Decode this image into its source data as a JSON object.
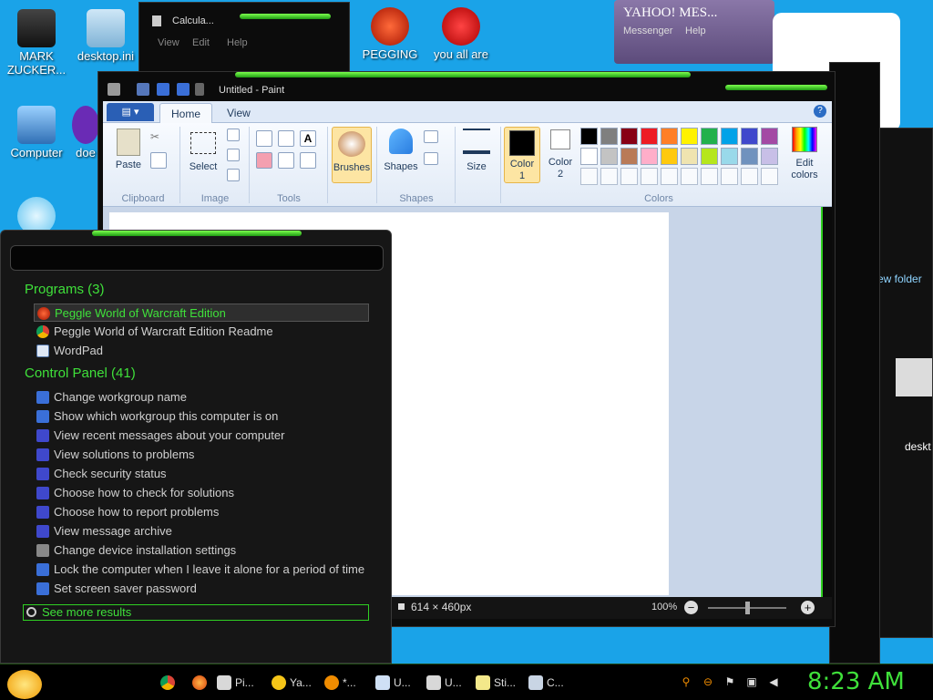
{
  "desktop": {
    "icons": [
      {
        "label": "MARK ZUCKER..."
      },
      {
        "label": "desktop.ini"
      },
      {
        "label": "PEGGING"
      },
      {
        "label": "you all are"
      },
      {
        "label": "Computer"
      },
      {
        "label": "doe"
      },
      {
        "label": "deskt"
      },
      {
        "label": "ew folder"
      }
    ]
  },
  "calculator": {
    "title": "Calcula...",
    "menu": [
      "View",
      "Edit",
      "Help"
    ]
  },
  "yahoo": {
    "logo": "YAHOO! MES...",
    "menu": [
      "Messenger",
      "Help"
    ]
  },
  "paint": {
    "title": "Untitled - Paint",
    "tabs": {
      "file": "▤ ▾",
      "home": "Home",
      "view": "View"
    },
    "help": "?",
    "clipboard": {
      "paste": "Paste",
      "group": "Clipboard"
    },
    "image": {
      "select": "Select",
      "group": "Image"
    },
    "tools": {
      "group": "Tools"
    },
    "brushes": "Brushes",
    "shapes": {
      "label": "Shapes",
      "group": "Shapes"
    },
    "size": "Size",
    "color1": "Color\n1",
    "color2": "Color\n2",
    "edit_colors": "Edit colors",
    "colors_group": "Colors",
    "palette_row1": [
      "#000000",
      "#7f7f7f",
      "#880015",
      "#ed1c24",
      "#ff7f27",
      "#fff200",
      "#22b14c",
      "#00a2e8",
      "#3f48cc",
      "#a349a4"
    ],
    "palette_row2": [
      "#ffffff",
      "#c3c3c3",
      "#b97a57",
      "#ffaec9",
      "#ffc90e",
      "#efe4b0",
      "#b5e61d",
      "#99d9ea",
      "#7092be",
      "#c8bfe7"
    ],
    "status": {
      "dimensions": "614 × 460px",
      "zoom": "100%"
    }
  },
  "startmenu": {
    "programs_header": "Programs (3)",
    "programs": [
      "Peggle World of Warcraft Edition",
      "Peggle World of Warcraft Edition Readme",
      "WordPad"
    ],
    "control_header": "Control Panel (41)",
    "control_items": [
      "Change workgroup name",
      "Show which workgroup this computer is on",
      "View recent messages about your computer",
      "View solutions to problems",
      "Check security status",
      "Choose how to check for solutions",
      "Choose how to report problems",
      "View message archive",
      "Change device installation settings",
      "Lock the computer when I leave it alone for a period of time",
      "Set screen saver password"
    ],
    "see_more": "See more results"
  },
  "taskbar": {
    "items": [
      "Pi...",
      "Ya...",
      "*...",
      "U...",
      "U...",
      "Sti...",
      "C..."
    ],
    "clock": "8:23 AM"
  }
}
